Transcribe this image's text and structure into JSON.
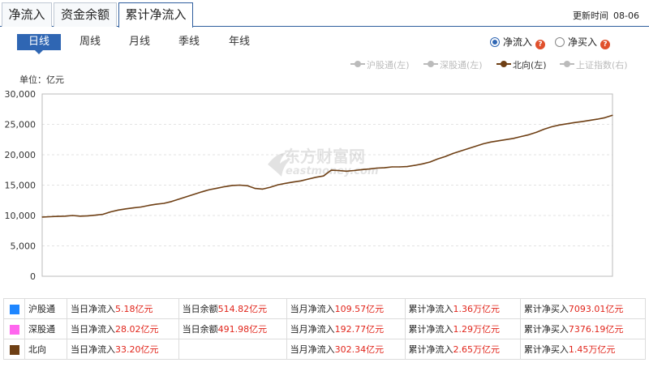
{
  "header": {
    "tabs": [
      {
        "label": "净流入",
        "active": false
      },
      {
        "label": "资金余额",
        "active": false
      },
      {
        "label": "累计净流入",
        "active": true
      }
    ],
    "update_label": "更新时间",
    "update_date": "08-06"
  },
  "period_tabs": [
    {
      "label": "日线",
      "active": true
    },
    {
      "label": "周线",
      "active": false
    },
    {
      "label": "月线",
      "active": false
    },
    {
      "label": "季线",
      "active": false
    },
    {
      "label": "年线",
      "active": false
    }
  ],
  "radios": [
    {
      "label": "净流入",
      "checked": true,
      "help": "?"
    },
    {
      "label": "净买入",
      "checked": false,
      "help": "?"
    }
  ],
  "legend": [
    {
      "label": "沪股通(左)",
      "active": false
    },
    {
      "label": "深股通(左)",
      "active": false
    },
    {
      "label": "北向(左)",
      "active": true
    },
    {
      "label": "上证指数(右)",
      "active": false
    }
  ],
  "unit": "单位：亿元",
  "watermark": {
    "brand": "东方财富网",
    "domain": "eastmoney.com"
  },
  "colors": {
    "line": "#6e3f14",
    "accent": "#2f66b3",
    "value_red": "#e1251b"
  },
  "chart_data": {
    "type": "line",
    "ylim": [
      0,
      30000
    ],
    "yticks": [
      "30,000",
      "25,000",
      "20,000",
      "15,000",
      "10,000",
      "5,000",
      "0"
    ],
    "grid": true,
    "series": [
      {
        "name": "北向(左)",
        "values": [
          9750,
          9800,
          9850,
          9900,
          10000,
          9900,
          9950,
          10050,
          10200,
          10600,
          10900,
          11100,
          11250,
          11400,
          11650,
          11850,
          12000,
          12300,
          12700,
          13100,
          13500,
          13900,
          14250,
          14500,
          14750,
          14950,
          15000,
          14900,
          14450,
          14350,
          14650,
          15050,
          15300,
          15500,
          15700,
          16000,
          16300,
          16500,
          17450,
          17400,
          17300,
          17400,
          17550,
          17650,
          17800,
          17850,
          18000,
          18000,
          18050,
          18250,
          18500,
          18800,
          19300,
          19700,
          20200,
          20600,
          21000,
          21400,
          21800,
          22100,
          22300,
          22500,
          22700,
          23000,
          23300,
          23700,
          24200,
          24600,
          24900,
          25100,
          25300,
          25450,
          25650,
          25850,
          26100,
          26500
        ]
      }
    ]
  },
  "summary": [
    {
      "name": "沪股通",
      "color": "#1e86ff",
      "cells": [
        "当日净流入",
        "5.18亿元",
        "当日余额",
        "514.82亿元",
        "当月净流入",
        "109.57亿元",
        "累计净流入",
        "1.36万亿元",
        "累计净买入",
        "7093.01亿元"
      ]
    },
    {
      "name": "深股通",
      "color": "#ff66ee",
      "cells": [
        "当日净流入",
        "28.02亿元",
        "当日余额",
        "491.98亿元",
        "当月净流入",
        "192.77亿元",
        "累计净流入",
        "1.29万亿元",
        "累计净买入",
        "7376.19亿元"
      ]
    },
    {
      "name": "北向",
      "color": "#6e3f14",
      "cells": [
        "当日净流入",
        "33.20亿元",
        "",
        "",
        "当月净流入",
        "302.34亿元",
        "累计净流入",
        "2.65万亿元",
        "累计净买入",
        "1.45万亿元"
      ]
    }
  ]
}
